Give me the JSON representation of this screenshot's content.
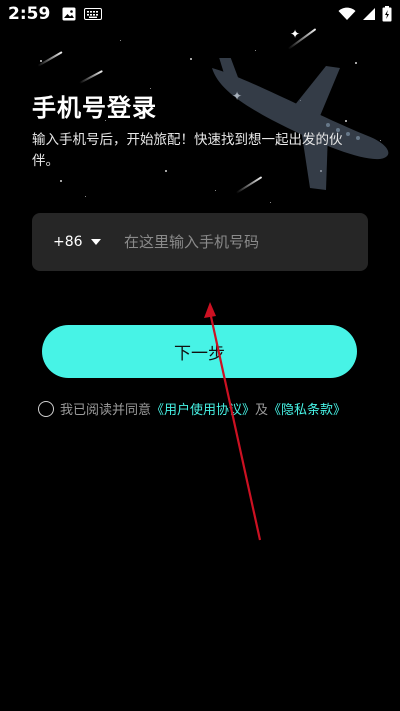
{
  "status_bar": {
    "time": "2:59"
  },
  "login": {
    "title": "手机号登录",
    "subtitle": "输入手机号后，开始旅配！快速找到想一起出发的伙伴。"
  },
  "phone": {
    "country_code": "+86",
    "placeholder": "在这里输入手机号码",
    "value": ""
  },
  "next_button": {
    "label": "下一步"
  },
  "agreement": {
    "prefix": "我已阅读并同意",
    "user_agreement": "《用户使用协议》",
    "and": "及",
    "privacy_policy": "《隐私条款》",
    "checked": false
  },
  "colors": {
    "accent": "#47f3e6",
    "background": "#000000",
    "input_bg": "#262626",
    "annotation": "#cc1122"
  }
}
